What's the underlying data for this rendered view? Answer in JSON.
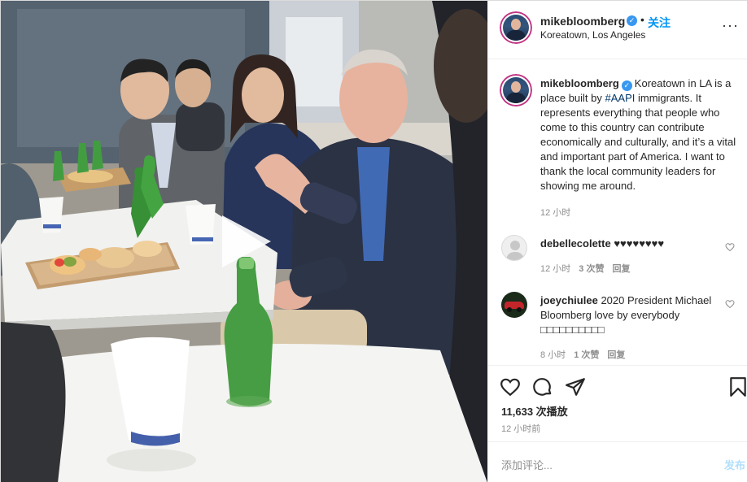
{
  "post": {
    "username": "mikebloomberg",
    "verified_glyph": "✓",
    "dot": "•",
    "follow_label": "关注",
    "location": "Koreatown, Los Angeles",
    "more_glyph": "···",
    "caption_before_tag": "Koreatown in LA is a place built by ",
    "caption_tag": "#AAPI",
    "caption_after_tag": " immigrants. It represents everything that people who come to this country can contribute economically and culturally, and it’s a vital and important part of America. I want to thank the local community leaders for showing me around.",
    "caption_time": "12 小时"
  },
  "comments": [
    {
      "username": "debellecolette",
      "text": "♥♥♥♥♥♥♥♥",
      "time": "12 小时",
      "likes": "3 次赞",
      "reply": "回复"
    },
    {
      "username": "joeychiulee",
      "text": "2020 President Michael Bloomberg love by everybody □□□□□□□□□□",
      "time": "8 小时",
      "likes": "1 次赞",
      "reply": "回复"
    }
  ],
  "engagement": {
    "likes": "11,633 次播放",
    "time": "12 小时前"
  },
  "composer": {
    "placeholder": "添加评论...",
    "post_label": "发布"
  },
  "icons": {
    "verified": "verified-badge-icon",
    "more": "more-options-icon",
    "play": "play-icon",
    "like": "heart-icon",
    "comment": "comment-icon",
    "share": "share-icon",
    "save": "bookmark-icon"
  },
  "colors": {
    "accent": "#0095f6",
    "verified": "#3897f0",
    "muted": "#8e8e8e",
    "post_disabled": "#b2dffc",
    "story_ring": "#c13584"
  }
}
